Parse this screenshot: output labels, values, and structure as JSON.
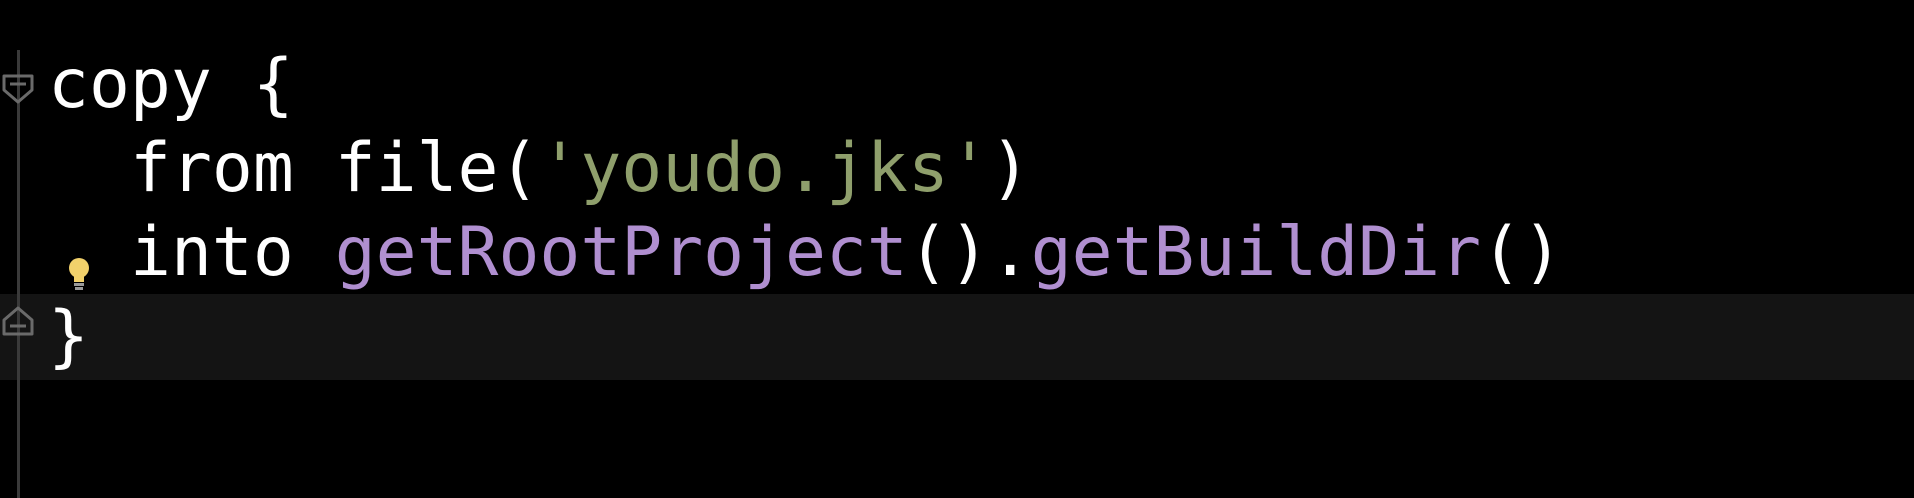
{
  "editor": {
    "lines": [
      {
        "tokens": [
          {
            "text": "copy {",
            "kind": "plain"
          }
        ]
      },
      {
        "tokens": [
          {
            "text": "from file(",
            "kind": "plain"
          },
          {
            "text": "'youdo.jks'",
            "kind": "string"
          },
          {
            "text": ")",
            "kind": "plain"
          }
        ]
      },
      {
        "tokens": [
          {
            "text": "into ",
            "kind": "plain"
          },
          {
            "text": "getRootProject",
            "kind": "method"
          },
          {
            "text": "().",
            "kind": "plain"
          },
          {
            "text": "getBuildDir",
            "kind": "method"
          },
          {
            "text": "()",
            "kind": "plain"
          }
        ]
      },
      {
        "tokens": [
          {
            "text": "}",
            "kind": "plain"
          }
        ]
      }
    ],
    "gutter_icons": {
      "fold_top": "fold-collapse-icon",
      "bulb": "lightbulb-icon",
      "fold_bottom": "fold-end-icon"
    },
    "colors": {
      "background": "#000000",
      "plain": "#ffffff",
      "string": "#8f9f6c",
      "method": "#b08fd0",
      "current_line": "#141414"
    }
  }
}
